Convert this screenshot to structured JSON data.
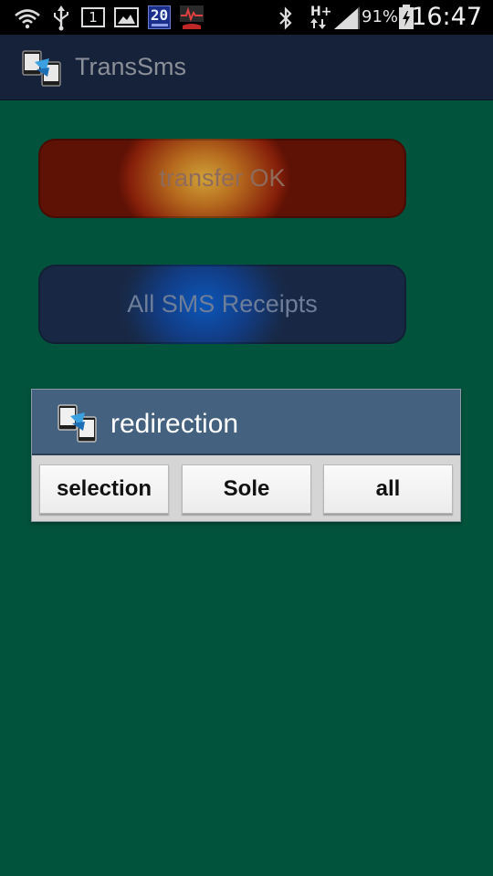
{
  "status_bar": {
    "notification_box_text": "1",
    "date_badge": "20",
    "network_type": "H+",
    "battery_percent": "91%",
    "time": "16:47"
  },
  "action_bar": {
    "app_title": "TransSms"
  },
  "main": {
    "transfer_button_label": "transfer OK",
    "receipts_button_label": "All SMS Receipts"
  },
  "dialog": {
    "title": "redirection",
    "buttons": [
      {
        "label": "selection"
      },
      {
        "label": "Sole"
      },
      {
        "label": "all"
      }
    ]
  },
  "colors": {
    "background": "#02533c",
    "action_bar": "#16223a",
    "dialog_header": "#44627f",
    "transfer_button": "#86200a",
    "receipts_button": "#172a4a"
  }
}
